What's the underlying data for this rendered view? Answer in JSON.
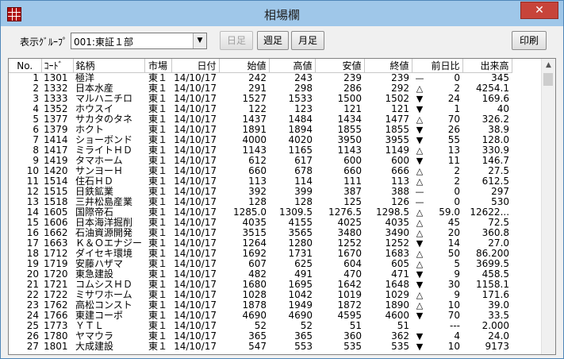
{
  "window": {
    "title": "相場欄"
  },
  "toolbar": {
    "group_label": "表示ｸﾞﾙｰﾌﾟ",
    "group_selected": "001:東証１部",
    "daily_btn": "日足",
    "weekly_btn": "週足",
    "monthly_btn": "月足",
    "print_btn": "印刷"
  },
  "table": {
    "headers": [
      "No.",
      "ｺｰﾄﾞ",
      "銘柄",
      "市場",
      "日付",
      "始値",
      "高値",
      "安値",
      "終値",
      "前日比",
      "出来高"
    ],
    "rows": [
      [
        "1",
        "1301",
        "極洋",
        "東１",
        "14/10/17",
        "242",
        "243",
        "239",
        "239",
        "—",
        "0",
        "345"
      ],
      [
        "2",
        "1332",
        "日本水産",
        "東１",
        "14/10/17",
        "291",
        "298",
        "286",
        "292",
        "△",
        "2",
        "4254.1"
      ],
      [
        "3",
        "1333",
        "マルハニチロ",
        "東１",
        "14/10/17",
        "1527",
        "1533",
        "1500",
        "1502",
        "▼",
        "24",
        "169.6"
      ],
      [
        "4",
        "1352",
        "ホウスイ",
        "東１",
        "14/10/17",
        "122",
        "123",
        "121",
        "121",
        "▼",
        "1",
        "40"
      ],
      [
        "5",
        "1377",
        "サカタのタネ",
        "東１",
        "14/10/17",
        "1437",
        "1484",
        "1434",
        "1477",
        "△",
        "70",
        "326.2"
      ],
      [
        "6",
        "1379",
        "ホクト",
        "東１",
        "14/10/17",
        "1891",
        "1894",
        "1855",
        "1855",
        "▼",
        "26",
        "38.9"
      ],
      [
        "7",
        "1414",
        "ショーボンド",
        "東１",
        "14/10/17",
        "4000",
        "4020",
        "3950",
        "3955",
        "▼",
        "55",
        "128.0"
      ],
      [
        "8",
        "1417",
        "ミライトＨＤ",
        "東１",
        "14/10/17",
        "1143",
        "1165",
        "1143",
        "1149",
        "△",
        "13",
        "330.9"
      ],
      [
        "9",
        "1419",
        "タマホーム",
        "東１",
        "14/10/17",
        "612",
        "617",
        "600",
        "600",
        "▼",
        "11",
        "146.7"
      ],
      [
        "10",
        "1420",
        "サンヨーＨ",
        "東１",
        "14/10/17",
        "660",
        "678",
        "660",
        "666",
        "△",
        "2",
        "27.5"
      ],
      [
        "11",
        "1514",
        "住石ＨＤ",
        "東１",
        "14/10/17",
        "113",
        "114",
        "111",
        "113",
        "△",
        "2",
        "612.5"
      ],
      [
        "12",
        "1515",
        "日鉄鉱業",
        "東１",
        "14/10/17",
        "392",
        "399",
        "387",
        "388",
        "—",
        "0",
        "297"
      ],
      [
        "13",
        "1518",
        "三井松島産業",
        "東１",
        "14/10/17",
        "128",
        "128",
        "125",
        "126",
        "—",
        "0",
        "530"
      ],
      [
        "14",
        "1605",
        "国際帝石",
        "東１",
        "14/10/17",
        "1285.0",
        "1309.5",
        "1276.5",
        "1298.5",
        "△",
        "59.0",
        "12622..."
      ],
      [
        "15",
        "1606",
        "日本海洋掘削",
        "東１",
        "14/10/17",
        "4035",
        "4155",
        "4025",
        "4035",
        "△",
        "45",
        "72.5"
      ],
      [
        "16",
        "1662",
        "石油資源開発",
        "東１",
        "14/10/17",
        "3515",
        "3565",
        "3480",
        "3490",
        "△",
        "20",
        "360.8"
      ],
      [
        "17",
        "1663",
        "Ｋ＆Ｏエナジー",
        "東１",
        "14/10/17",
        "1264",
        "1280",
        "1252",
        "1252",
        "▼",
        "14",
        "27.0"
      ],
      [
        "18",
        "1712",
        "ダイセキ環境",
        "東１",
        "14/10/17",
        "1692",
        "1731",
        "1670",
        "1683",
        "△",
        "50",
        "86.200"
      ],
      [
        "19",
        "1719",
        "安藤ハザマ",
        "東１",
        "14/10/17",
        "607",
        "625",
        "604",
        "605",
        "△",
        "5",
        "3699.5"
      ],
      [
        "20",
        "1720",
        "東急建設",
        "東１",
        "14/10/17",
        "482",
        "491",
        "470",
        "471",
        "▼",
        "9",
        "458.5"
      ],
      [
        "21",
        "1721",
        "コムシスＨＤ",
        "東１",
        "14/10/17",
        "1680",
        "1695",
        "1642",
        "1648",
        "▼",
        "30",
        "1158.1"
      ],
      [
        "22",
        "1722",
        "ミサワホーム",
        "東１",
        "14/10/17",
        "1028",
        "1042",
        "1019",
        "1029",
        "△",
        "9",
        "171.6"
      ],
      [
        "23",
        "1762",
        "高松コンスト",
        "東１",
        "14/10/17",
        "1878",
        "1949",
        "1872",
        "1890",
        "△",
        "10",
        "39.0"
      ],
      [
        "24",
        "1766",
        "東建コーポ",
        "東１",
        "14/10/17",
        "4690",
        "4690",
        "4595",
        "4600",
        "▼",
        "70",
        "33.5"
      ],
      [
        "25",
        "1773",
        "ＹＴＬ",
        "東１",
        "14/10/17",
        "52",
        "52",
        "51",
        "51",
        "",
        "---",
        "2.000"
      ],
      [
        "26",
        "1780",
        "ヤマウラ",
        "東１",
        "14/10/17",
        "365",
        "365",
        "360",
        "362",
        "▼",
        "4",
        "24.0"
      ],
      [
        "27",
        "1801",
        "大成建設",
        "東１",
        "14/10/17",
        "547",
        "553",
        "535",
        "535",
        "▼",
        "10",
        "9173"
      ]
    ]
  }
}
